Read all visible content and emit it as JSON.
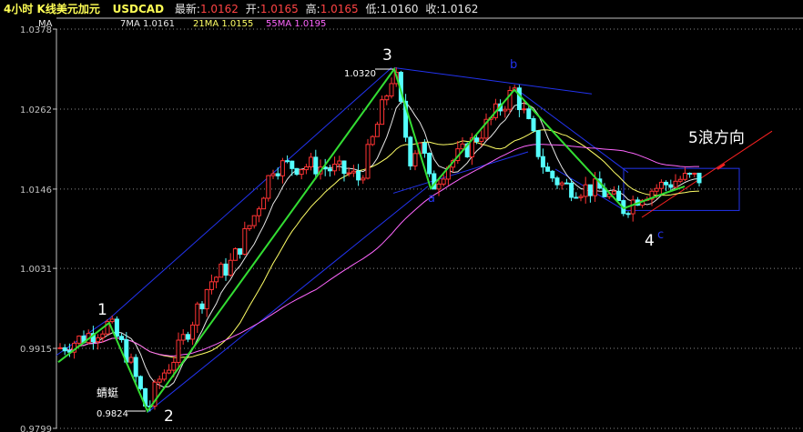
{
  "header": {
    "title": "4小时 K线美元加元",
    "symbol": "USDCAD",
    "latest_label": "最新:",
    "latest": "1.0162",
    "open_label": "开:",
    "open": "1.0165",
    "high_label": "高:",
    "high": "1.0165",
    "low_label": "低:",
    "low": "1.0160",
    "close_label": "收:",
    "close": "1.0162"
  },
  "ma_legend": {
    "name": "MA",
    "ma7": "7MA 1.0161",
    "ma21": "21MA 1.0155",
    "ma55": "55MA 1.0195"
  },
  "annotations": {
    "wave1": "1",
    "wave2": "2",
    "wave3": "3",
    "wave4": "4",
    "wave_a": "a",
    "wave_b": "b",
    "wave_c": "c",
    "wave5_direction": "5浪方向",
    "dragonfly": "蜻蜓",
    "price_high": "1.0320",
    "price_low": "0.9824"
  },
  "colors": {
    "up": "#ff3333",
    "down": "#55ffff",
    "ma7": "#e6e6e6",
    "ma21": "#ffff66",
    "ma55": "#ff66ff",
    "wave": "#33dd33",
    "channel": "#2233ee",
    "trend": "#ff2222",
    "grid": "#8a8a8a",
    "axis": "#c0c0c0"
  },
  "chart_data": {
    "type": "candlestick",
    "title": "4小时 K线美元加元 USDCAD",
    "y_ticks": [
      1.0378,
      1.0262,
      1.0146,
      1.0031,
      0.9915,
      0.9799
    ],
    "ylim": [
      0.9799,
      1.0378
    ],
    "grid": "horizontal dotted",
    "series": [
      {
        "name": "7MA",
        "last": 1.0161
      },
      {
        "name": "21MA",
        "last": 1.0155
      },
      {
        "name": "55MA",
        "last": 1.0195
      }
    ],
    "waves": [
      {
        "label": "1",
        "price": 0.995
      },
      {
        "label": "2",
        "price": 0.9824
      },
      {
        "label": "3",
        "price": 1.032
      },
      {
        "label": "a",
        "price": 1.0147
      },
      {
        "label": "b",
        "price": 1.029
      },
      {
        "label": "4",
        "price": 1.0118
      }
    ]
  }
}
